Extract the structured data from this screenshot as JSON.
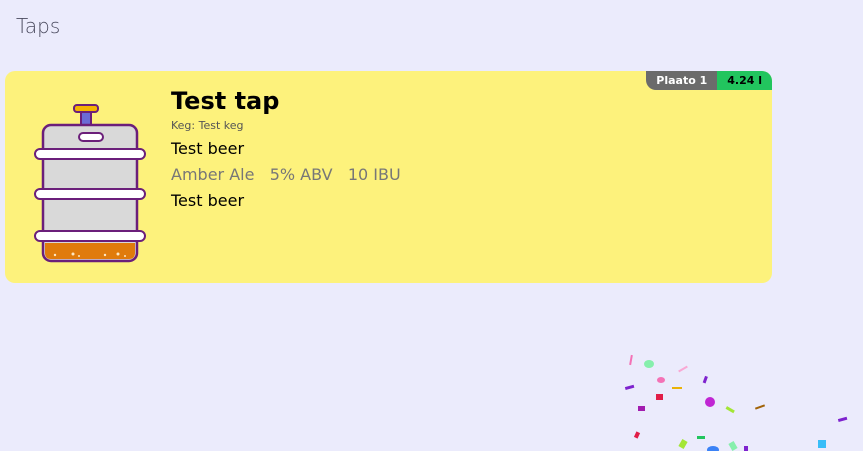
{
  "page": {
    "title": "Taps"
  },
  "tap": {
    "name": "Test tap",
    "keg_label": "Keg: Test keg",
    "beer_name": "Test beer",
    "style": "Amber Ale",
    "abv": "5% ABV",
    "ibu": "10 IBU",
    "beer_name_repeat": "Test beer",
    "device_badge": "Plaato 1",
    "volume_badge": "4.24 l",
    "icon": "keg-icon"
  },
  "colors": {
    "background": "#ebebfc",
    "card": "#fdf27c",
    "badge_device": "#6b6b6b",
    "badge_volume": "#22c55e",
    "keg_outline": "#6b1f7a",
    "keg_body": "#d9d9d9",
    "beer_fill": "#e07b0c"
  }
}
